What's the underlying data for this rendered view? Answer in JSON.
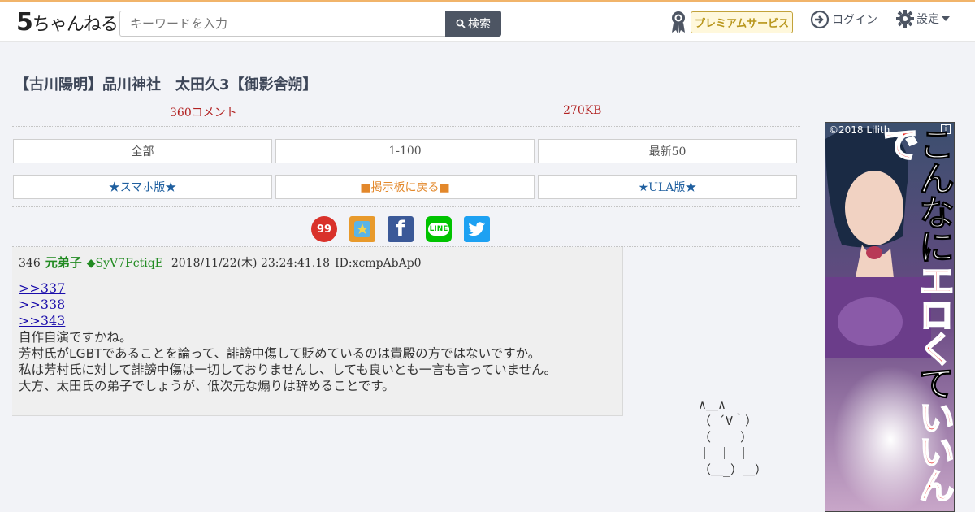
{
  "header": {
    "logo_main": "5",
    "logo_sub": "ちゃんねる",
    "logo_dot": ".",
    "search_placeholder": "キーワードを入力",
    "search_button": "検索",
    "premium_label": "プレミアムサービス",
    "login_label": "ログイン",
    "settings_label": "設定"
  },
  "thread": {
    "title": "【古川陽明】品川神社　太田久3【御影舎朔】",
    "comments": "360コメント",
    "size": "270KB"
  },
  "nav": {
    "row1": [
      "全部",
      "1-100",
      "最新50"
    ],
    "row2": [
      "★スマホ版★",
      "■掲示板に戻る■",
      "★ULA版★"
    ]
  },
  "share": {
    "icons": [
      "5ch-icon",
      "bookmark-icon",
      "facebook-icon",
      "line-icon",
      "twitter-icon"
    ],
    "five_text": "99",
    "fb_text": "f",
    "line_text": "LINE"
  },
  "post": {
    "number": "346",
    "name": "元弟子",
    "trip": "◆SyV7FctiqE",
    "date": "2018/11/22(木) 23:24:41.18",
    "id": "ID:xcmpAbAp0",
    "links": [
      ">>337",
      ">>338",
      ">>343"
    ],
    "lines": [
      "自作自演ですかね。",
      "芳村氏がLGBTであることを論って、誹謗中傷して貶めているのは貴殿の方ではないですか。",
      "私は芳村氏に対して誹謗中傷は一切しておりませんし、しても良いとも一言も言っていません。",
      "大方、太田氏の弟子でしょうが、低次元な煽りは辞めることです。"
    ]
  },
  "ascii_art": "∧＿∧\n（ ´∀｀）\n（    ）\n｜ ｜ ｜\n（＿_）＿）",
  "ad": {
    "copyright": "©2018 Lilith",
    "info": "i",
    "text_white_1": "こんな",
    "text_white_2": "に",
    "text_red": "エロく",
    "text_white_3": "て",
    "text_red_2": "いいんで"
  },
  "colors": {
    "accent_orange": "#f1b46a",
    "link_blue": "#1a0dab",
    "name_green": "#228b22",
    "meta_red": "#b22222"
  }
}
